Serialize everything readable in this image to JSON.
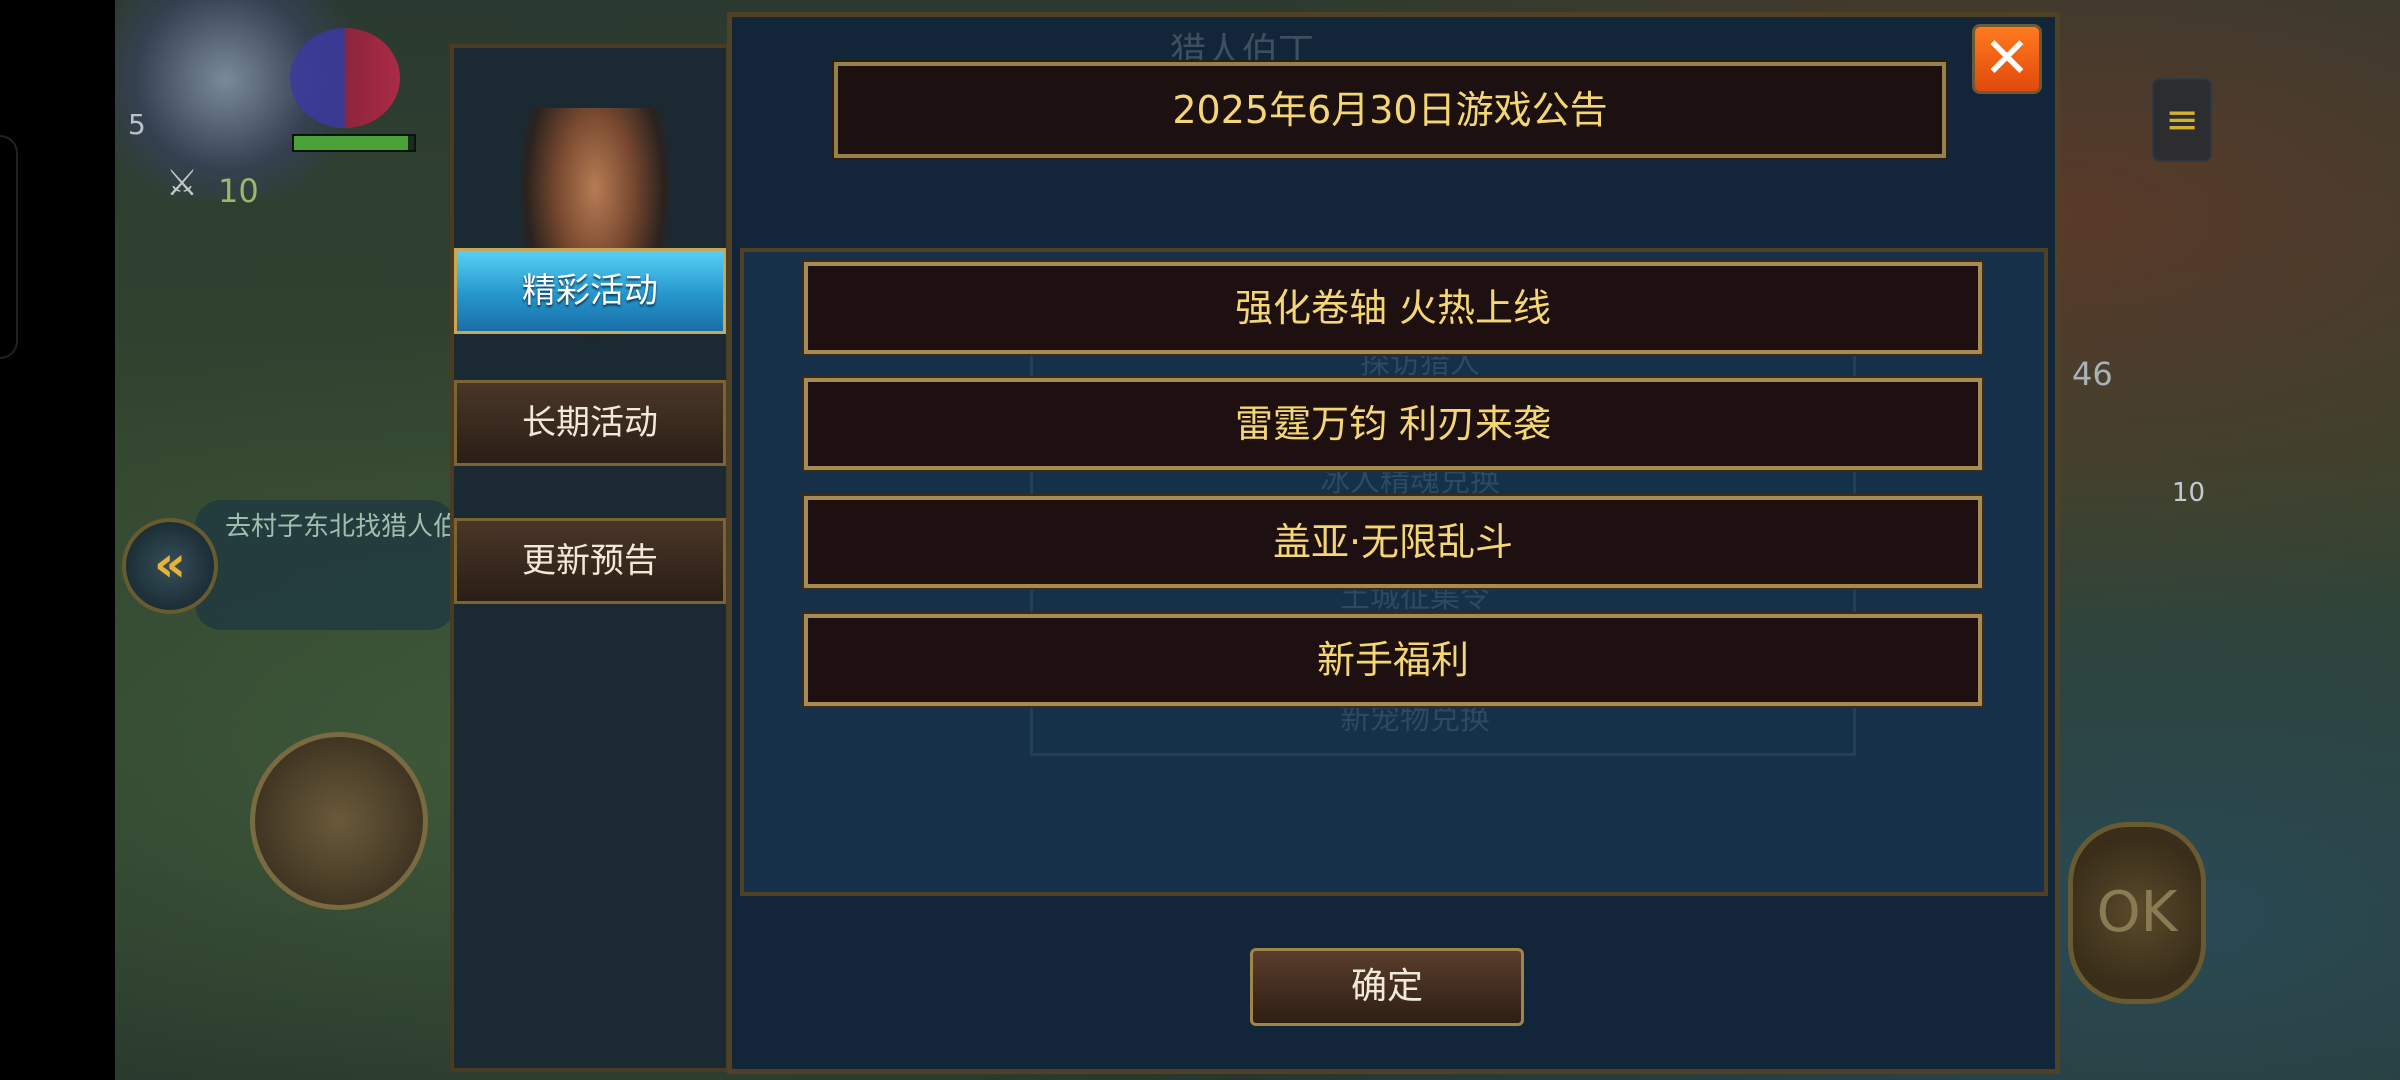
{
  "hud": {
    "player_level": "5",
    "power": "10",
    "quest_text": "去村子东北找猎人伯",
    "right_count": "46",
    "item_count": "10",
    "ok_label": "OK"
  },
  "dialog": {
    "ghost_title": "猎人伯丁",
    "title": "2025年6月30日游戏公告",
    "tabs": [
      {
        "label": "精彩活动",
        "active": true
      },
      {
        "label": "长期活动",
        "active": false
      },
      {
        "label": "更新预告",
        "active": false
      }
    ],
    "announcements": [
      {
        "label": "强化卷轴 火热上线"
      },
      {
        "label": "雷霆万钧 利刃来袭"
      },
      {
        "label": "盖亚·无限乱斗"
      },
      {
        "label": "新手福利"
      }
    ],
    "ghost_lines": [
      "探访猎人",
      "冰人精魂兑换",
      "土城征集令",
      "新宠物兑换"
    ],
    "confirm_label": "确定",
    "close_symbol": "✕"
  },
  "colors": {
    "accent_gold": "#f4d774",
    "active_tab": "#2596cc",
    "close_orange": "#ff6a1a",
    "panel_blue": "#132538"
  }
}
